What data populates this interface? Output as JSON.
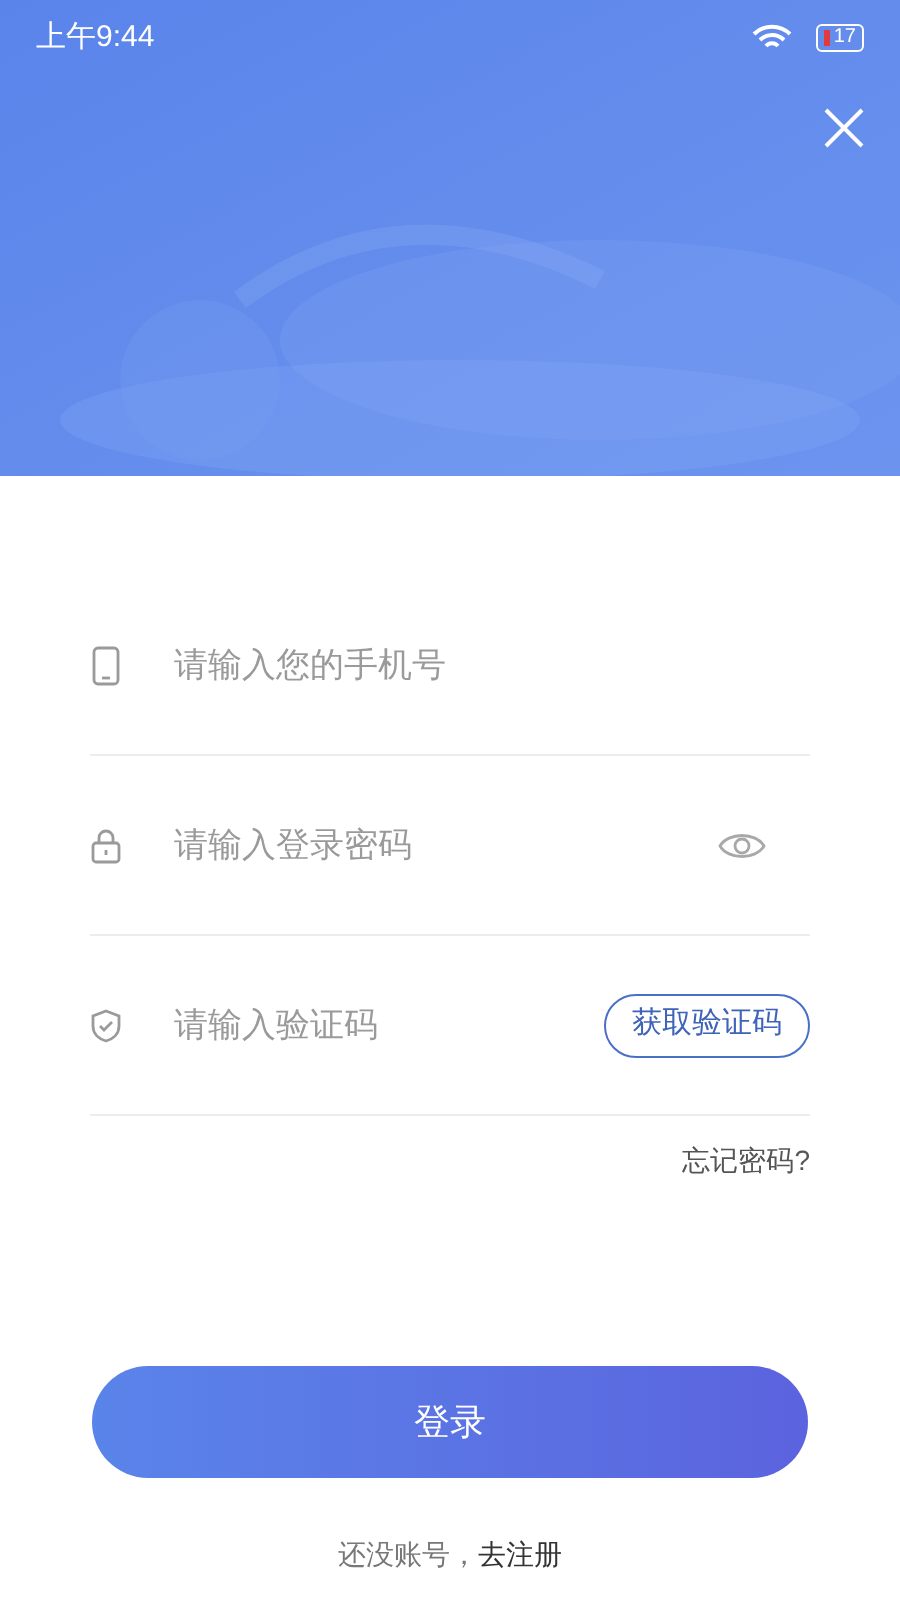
{
  "status_bar": {
    "time": "上午9:44",
    "battery": "17"
  },
  "fields": [
    {
      "kind": "phone",
      "placeholder": "请输入您的手机号"
    },
    {
      "kind": "password",
      "placeholder": "请输入登录密码"
    },
    {
      "kind": "code",
      "placeholder": "请输入验证码",
      "action": "获取验证码"
    }
  ],
  "forgot_link": "忘记密码?",
  "login_button": "登录",
  "register": {
    "prompt": "还没账号，",
    "link": "去注册"
  }
}
